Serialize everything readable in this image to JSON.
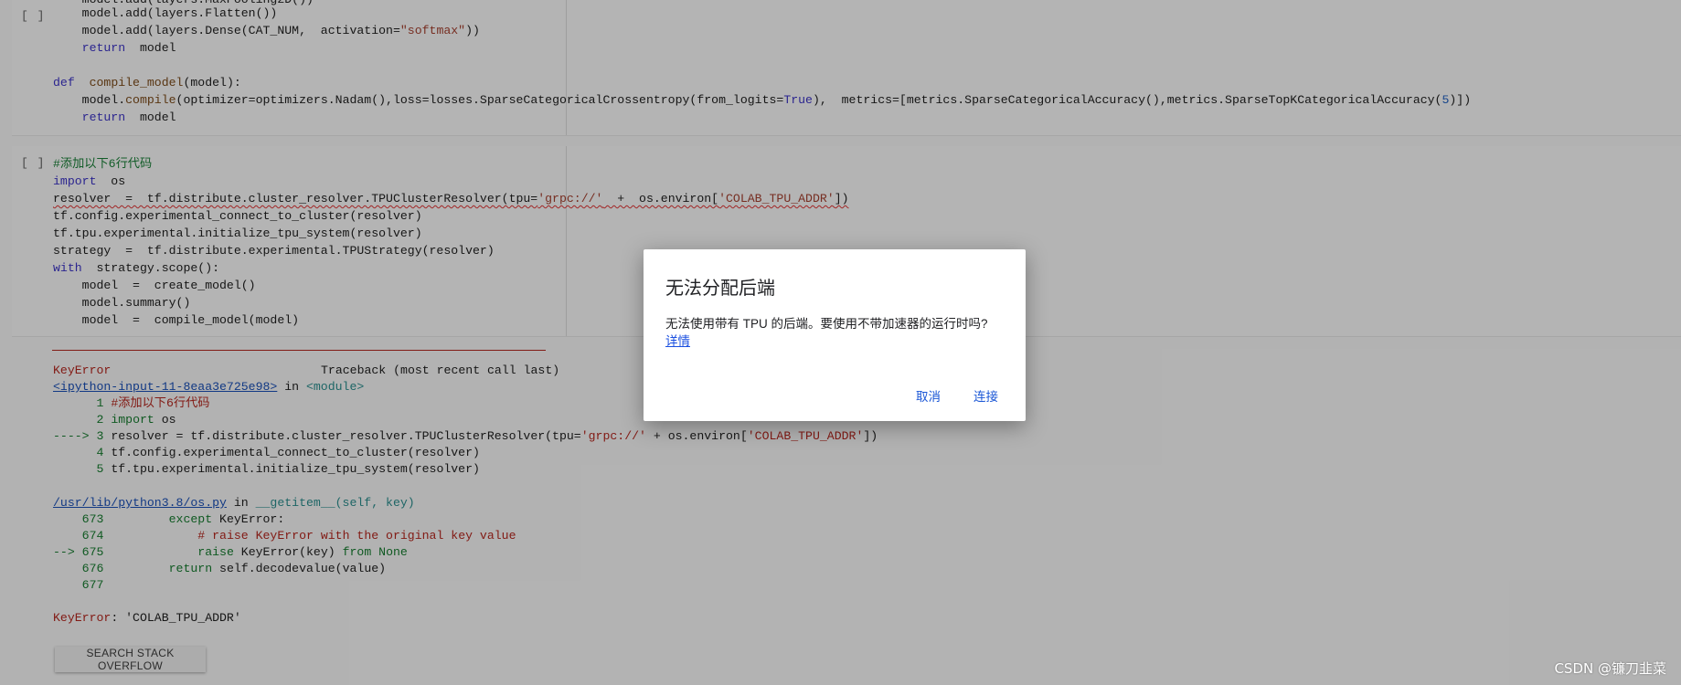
{
  "cell1": {
    "run_label": "[ ]",
    "lines": [
      "    model.add(layers.Flatten())",
      "    model.add(layers.Dense(CAT_NUM,  activation=\"softmax\"))",
      "    return  model",
      "",
      "def  compile_model(model):",
      "    model.compile(optimizer=optimizers.Nadam(),loss=losses.SparseCategoricalCrossentropy(from_logits=True),  metrics=[metrics.SparseCategoricalAccuracy(),metrics.SparseTopKCategoricalAccuracy(5)])",
      "    return  model"
    ]
  },
  "cell2": {
    "run_label": "[ ]",
    "lines": [
      "#添加以下6行代码",
      "import  os",
      "resolver  =  tf.distribute.cluster_resolver.TPUClusterResolver(tpu='grpc://'  +  os.environ['COLAB_TPU_ADDR'])",
      "tf.config.experimental_connect_to_cluster(resolver)",
      "tf.tpu.experimental.initialize_tpu_system(resolver)",
      "strategy  =  tf.distribute.experimental.TPUStrategy(resolver)",
      "with  strategy.scope():",
      "    model  =  create_model()",
      "    model.summary()",
      "    model  =  compile_model(model)"
    ]
  },
  "traceback": {
    "error_name": "KeyError",
    "header_right": "Traceback (most recent call last)",
    "frame1_link": "<ipython-input-11-8eaa3e725e98>",
    "frame1_in": " in ",
    "frame1_module": "<module>",
    "frame1_lines": [
      "      1 #添加以下6行代码",
      "      2 import os",
      "----> 3 resolver = tf.distribute.cluster_resolver.TPUClusterResolver(tpu='grpc://' + os.environ['COLAB_TPU_ADDR'])",
      "      4 tf.config.experimental_connect_to_cluster(resolver)",
      "      5 tf.tpu.experimental.initialize_tpu_system(resolver)"
    ],
    "frame2_link": "/usr/lib/python3.8/os.py",
    "frame2_in": " in ",
    "frame2_func": "__getitem__(self, key)",
    "frame2_lines": [
      "    673         except KeyError:",
      "    674             # raise KeyError with the original key value",
      "--> 675             raise KeyError(key) from None",
      "    676         return self.decodevalue(value)",
      "    677"
    ],
    "final_error": "KeyError: 'COLAB_TPU_ADDR'",
    "search_button": "SEARCH STACK OVERFLOW"
  },
  "dialog": {
    "title": "无法分配后端",
    "body": "无法使用带有 TPU 的后端。要使用不带加速器的运行时吗?",
    "link": "详情",
    "cancel": "取消",
    "connect": "连接"
  },
  "watermark": "CSDN @镰刀韭菜",
  "colors": {
    "dialog_button": "#1a56d6",
    "error_red": "#b3261e",
    "link_blue": "#1a4fb5"
  }
}
